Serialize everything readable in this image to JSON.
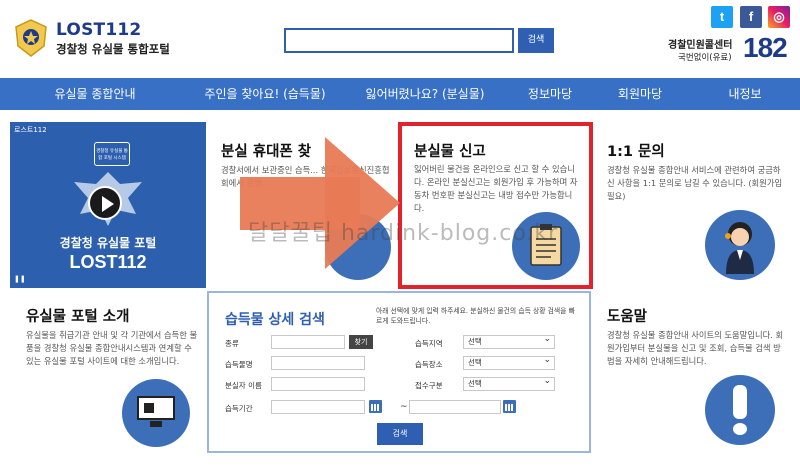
{
  "header": {
    "brand_name": "LOST112",
    "brand_sub": "경찰청 유실물 통합포털",
    "search_button": "검색",
    "social": {
      "twitter": "t",
      "facebook": "f",
      "instagram": "◎"
    },
    "call_center": {
      "label": "경찰민원콜센터",
      "sub": "국번없이(유료)",
      "number": "182"
    }
  },
  "nav": {
    "items": [
      {
        "label": "유실물 종합안내"
      },
      {
        "label": "주인을 찾아요! (습득물)"
      },
      {
        "label": "잃어버렸나요? (분실물)"
      },
      {
        "label": "정보마당"
      },
      {
        "label": "회원마당"
      },
      {
        "label": "내정보"
      }
    ]
  },
  "video": {
    "label": "로스트112",
    "badge": "경찰청 유실물 통합 포털 시스템",
    "title1": "경찰청 유실물 포털",
    "title2": "LOST112"
  },
  "cards": {
    "phone": {
      "title": "분실 휴대폰 찾",
      "desc": "경찰서에서 보관중인 습득... 한국정보통신진흥협회에서 운영..."
    },
    "report": {
      "title": "분실물 신고",
      "desc": "잃어버린 물건을 온라인으로 신고 할 수 있습니다. 온라인 분실신고는 회원가입 후 가능하며 자동차 번호판 분실신고는 내방 접수만 가능합니다."
    },
    "inquiry": {
      "title": "1:1 문의",
      "desc": "경찰청 유실물 종합안내 서비스에 관련하여 궁금하신 사항을 1:1 문의로 남길 수 있습니다. (회원가입 필요)"
    },
    "intro": {
      "title": "유실물 포털 소개",
      "desc": "유실물을 취급기관 안내 및 각 기관에서 습득한 물품을 경찰청 유실물 종합안내시스템과 연계할 수 있는 유실물 포털 사이트에 대한 소개입니다."
    },
    "help": {
      "title": "도움말",
      "desc": "경찰청 유실물 종합안내 사이트의 도움말입니다. 회원가입부터 분실물을 신고 및 조회, 습득물 검색 방법을 자세히 안내해드립니다."
    }
  },
  "watermark": "달달꿀팁 hardink-blog.co.kr",
  "search_panel": {
    "title": "습득물 상세 검색",
    "note": "아래 선택에 맞게 입력 하주세요. 분실하신 물건의 습득 상황 검색을 빠르게 도와드립니다.",
    "fields": {
      "category": "종류",
      "find_button": "찾기",
      "item_name": "습득물명",
      "owner_name": "분실자 이름",
      "period": "습득기간",
      "region": "습득지역",
      "place": "습득장소",
      "receipt": "접수구분",
      "select_default": "선택",
      "tilde": "~"
    },
    "search_button": "검색"
  },
  "colors": {
    "brand": "#1e3a8a",
    "nav": "#3770c4",
    "accent": "#2f5fb3",
    "highlight": "#e0232d",
    "arrow": "#e87a55"
  }
}
